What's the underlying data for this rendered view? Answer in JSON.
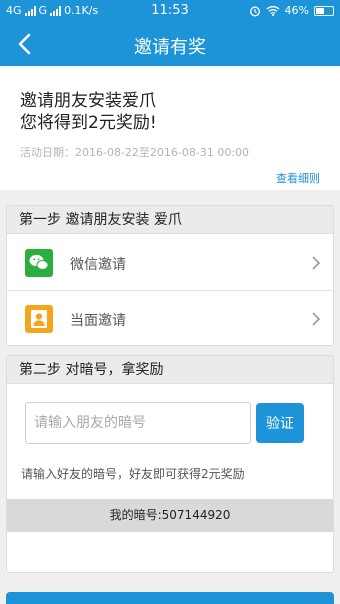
{
  "status_bar": {
    "network_left": "4G",
    "network_right": "G",
    "speed": "0.1K/s",
    "time": "11:53",
    "battery": "46%"
  },
  "nav": {
    "title": "邀请有奖"
  },
  "intro": {
    "line1": "邀请朋友安装爱爪",
    "line2": "您将得到2元奖励!",
    "date_label": "活动日期：",
    "date_range": "2016-08-22至2016-08-31 00:00",
    "details_link": "查看细则"
  },
  "step1": {
    "title": "第一步 邀请朋友安装 爱爪",
    "options": [
      {
        "label": "微信邀请",
        "icon": "wechat-icon"
      },
      {
        "label": "当面邀请",
        "icon": "person-icon"
      }
    ]
  },
  "step2": {
    "title": "第二步 对暗号，拿奖励",
    "input_placeholder": "请输入朋友的暗号",
    "verify_label": "验证",
    "hint": "请输入好友的暗号，好友即可获得2元奖励",
    "my_code": "我的暗号:507144920"
  },
  "colors": {
    "primary": "#1d93d8",
    "wechat": "#2aae3d",
    "person": "#f4a51c"
  }
}
